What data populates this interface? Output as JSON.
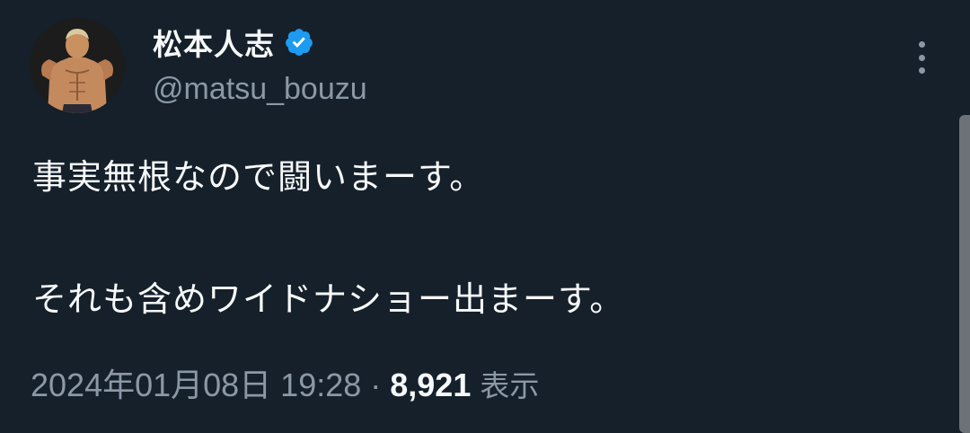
{
  "author": {
    "display_name": "松本人志",
    "handle": "@matsu_bouzu",
    "verified": true,
    "verified_color": "#1d9bf0"
  },
  "tweet": {
    "lines": [
      "事実無根なので闘いまーす。",
      "それも含めワイドナショー出まーす。"
    ],
    "timestamp": "2024年01月08日 19:28",
    "separator": "·",
    "view_count": "8,921",
    "views_label": "表示"
  },
  "colors": {
    "background": "#15202b",
    "text_primary": "#f7f9f9",
    "text_secondary": "#8b98a5"
  }
}
